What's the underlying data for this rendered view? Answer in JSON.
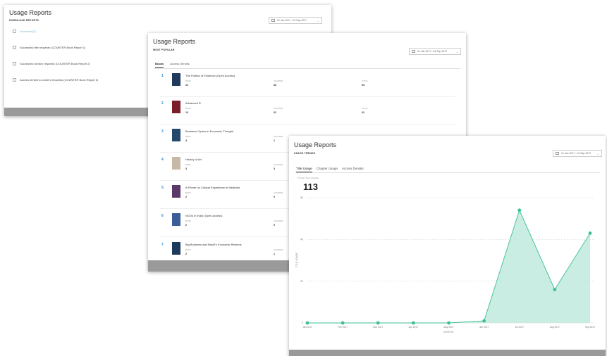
{
  "panels": {
    "download": {
      "title": "Usage Reports",
      "subtitle": "DOWNLOAD REPORTS",
      "date_range": "01 Jan 2017 - 04 Sep 2017",
      "items": [
        {
          "label": "Download(3)",
          "link": true
        },
        {
          "label": "Successful title requests (COUNTER Book Report 1)",
          "link": false
        },
        {
          "label": "Successful section requests (COUNTER Book Report 2)",
          "link": false
        },
        {
          "label": "Access denied to content requests (COUNTER Book Report 3)",
          "link": false
        }
      ]
    },
    "popular": {
      "title": "Usage Reports",
      "subtitle": "MOST POPULAR",
      "date_range": "01 Jan 2017 - 04 Sep 2017",
      "tabs": [
        "Books",
        "Access Denials"
      ],
      "col_labels": {
        "book": "BOOK",
        "chapter": "CHAPTER",
        "total": "TOTAL"
      },
      "books": [
        {
          "rank": "1",
          "title": "The Politics of Evidence (Open Access)",
          "book": "12",
          "chapter": "42",
          "total": "54",
          "cover": "#1f3a5a"
        },
        {
          "rank": "2",
          "title": "Advanced R",
          "book": "10",
          "chapter": "31",
          "total": "41",
          "cover": "#7a1e2a"
        },
        {
          "rank": "3",
          "title": "Business Cycles in Economic Thought",
          "book": "4",
          "chapter": "1",
          "total": "",
          "cover": "#23486b"
        },
        {
          "rank": "4",
          "title": "History of Art",
          "book": "3",
          "chapter": "3",
          "total": "",
          "cover": "#c8b8a8"
        },
        {
          "rank": "5",
          "title": "A Primer on Clinical Experience in Medicine",
          "book": "2",
          "chapter": "0",
          "total": "",
          "cover": "#5b3a6a"
        },
        {
          "rank": "6",
          "title": "NGOs in India (Open Access)",
          "book": "2",
          "chapter": "0",
          "total": "",
          "cover": "#3b5e98"
        },
        {
          "rank": "7",
          "title": "Big Business and Brazil's Economic Reforms",
          "book": "2",
          "chapter": "1",
          "total": "",
          "cover": "#1d3a5a"
        }
      ]
    },
    "trends": {
      "title": "Usage Reports",
      "subtitle": "USAGE TRENDS",
      "date_range": "01 Jan 2017 - 04 Sep 2017",
      "tabs": [
        "Title Usage",
        "Chapter Usage",
        "Access Denials"
      ],
      "total_label": "TOTAL TITLE USAGE",
      "total_value": "113"
    }
  },
  "colors": {
    "accent_fill": "#bfeadd",
    "accent_line": "#3cbf94",
    "rank_blue": "#2a8ad4",
    "link_blue": "#7fb6d8"
  },
  "chart_data": {
    "type": "area",
    "categories": [
      "Jan 2017",
      "Feb 2017",
      "Mar 2017",
      "Apr 2017",
      "May 2017",
      "Jun 2017",
      "Jul 2017",
      "Aug 2017",
      "Sep 2017"
    ],
    "values": [
      0,
      0,
      0,
      0,
      0,
      1,
      54,
      16,
      43
    ],
    "xlabel": "MONTHS",
    "ylabel": "TITLE USAGE",
    "yticks": [
      0,
      20,
      40,
      60
    ],
    "ylim": [
      0,
      60
    ],
    "grid": true
  }
}
